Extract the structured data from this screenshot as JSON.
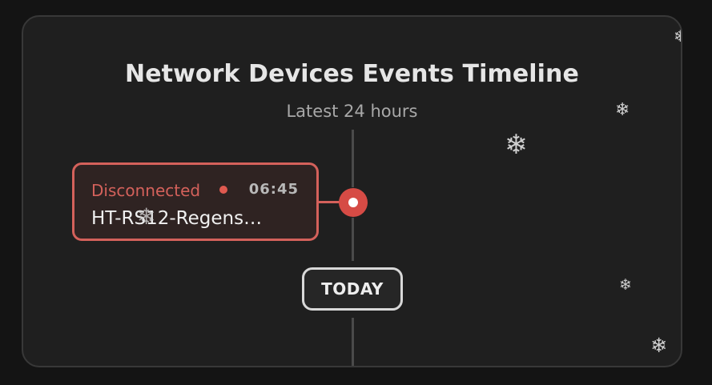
{
  "header": {
    "title": "Network Devices Events Timeline",
    "subtitle": "Latest 24 hours"
  },
  "events": [
    {
      "status": "Disconnected",
      "time": "06:45",
      "device": "HT-RS12-Regens…",
      "status_color": "#d4615b"
    }
  ],
  "timeline": {
    "today_label": "TODAY"
  },
  "decorations": {
    "snowflake_icon": "snowflake-icon"
  },
  "colors": {
    "background": "#141414",
    "card": "#1f1f1f",
    "accent_red": "#d64b45"
  }
}
